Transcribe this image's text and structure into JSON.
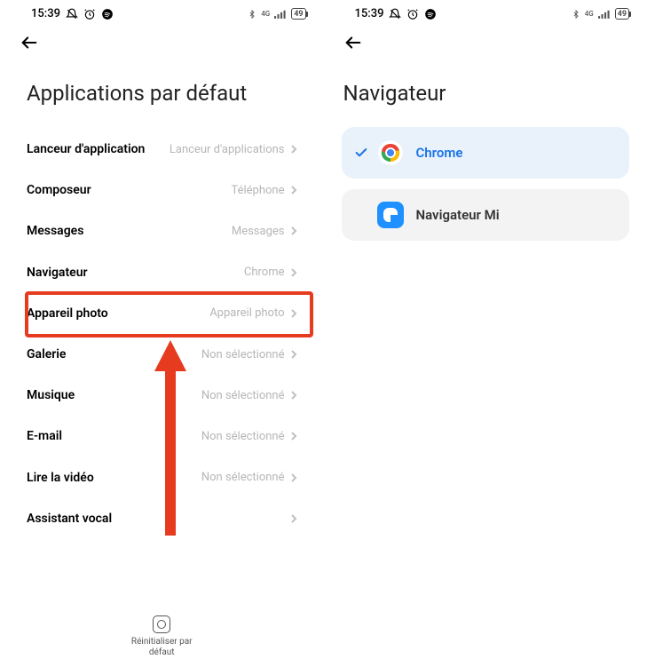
{
  "status": {
    "time": "15:39",
    "battery": "49"
  },
  "left": {
    "title": "Applications par défaut",
    "items": [
      {
        "label": "Lanceur d'application",
        "value": "Lanceur d'applications"
      },
      {
        "label": "Composeur",
        "value": "Téléphone"
      },
      {
        "label": "Messages",
        "value": "Messages"
      },
      {
        "label": "Navigateur",
        "value": "Chrome"
      },
      {
        "label": "Appareil photo",
        "value": "Appareil photo"
      },
      {
        "label": "Galerie",
        "value": "Non sélectionné"
      },
      {
        "label": "Musique",
        "value": "Non sélectionné"
      },
      {
        "label": "E-mail",
        "value": "Non sélectionné"
      },
      {
        "label": "Lire la vidéo",
        "value": "Non sélectionné"
      },
      {
        "label": "Assistant vocal",
        "value": ""
      }
    ],
    "reset_label": "Réinitialiser par défaut"
  },
  "right": {
    "title": "Navigateur",
    "items": [
      {
        "label": "Chrome",
        "selected": true
      },
      {
        "label": "Navigateur Mi",
        "selected": false
      }
    ]
  }
}
